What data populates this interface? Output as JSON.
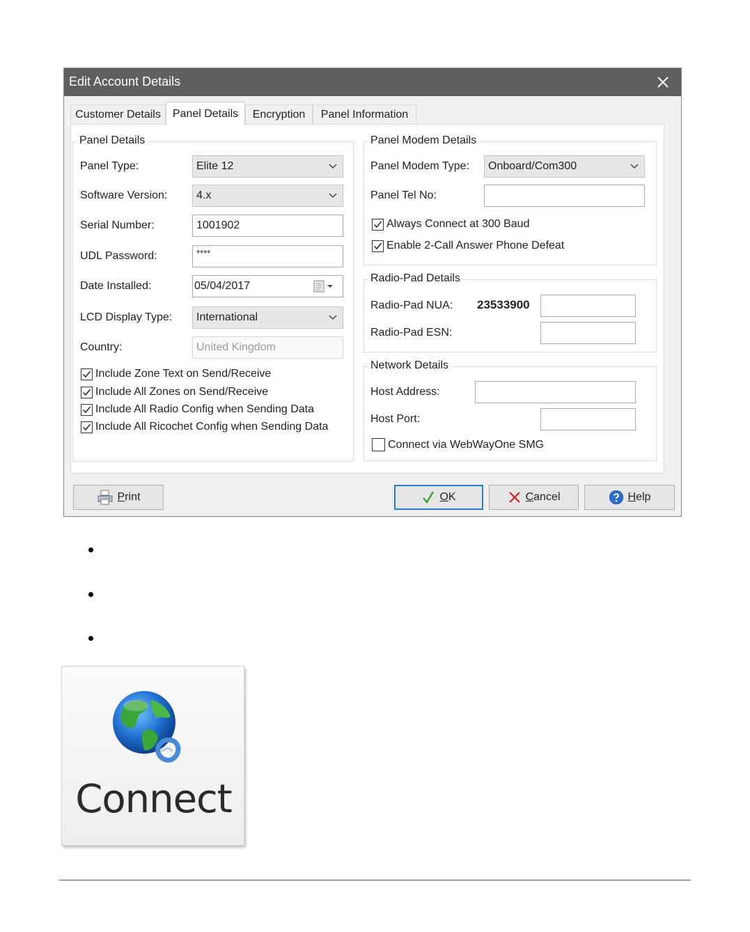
{
  "dialog": {
    "title": "Edit Account Details",
    "tabs": [
      "Customer Details",
      "Panel Details",
      "Encryption",
      "Panel Information"
    ],
    "panel_details": {
      "legend": "Panel Details",
      "panel_type_label": "Panel Type:",
      "panel_type_value": "Elite 12",
      "software_version_label": "Software Version:",
      "software_version_value": "4.x",
      "serial_number_label": "Serial Number:",
      "serial_number_value": "1001902",
      "udl_password_label": "UDL Password:",
      "udl_password_value": "****",
      "date_installed_label": "Date Installed:",
      "date_installed_value": "05/04/2017",
      "lcd_display_type_label": "LCD Display Type:",
      "lcd_display_type_value": "International",
      "country_label": "Country:",
      "country_value": "United Kingdom",
      "checkboxes": [
        {
          "label": "Include Zone Text on Send/Receive",
          "checked": true
        },
        {
          "label": "Include All Zones on Send/Receive",
          "checked": true
        },
        {
          "label": "Include All Radio Config when Sending Data",
          "checked": true
        },
        {
          "label": "Include All Ricochet Config when Sending Data",
          "checked": true
        }
      ]
    },
    "panel_modem_details": {
      "legend": "Panel Modem Details",
      "modem_type_label": "Panel Modem Type:",
      "modem_type_value": "Onboard/Com300",
      "tel_no_label": "Panel Tel No:",
      "tel_no_value": "",
      "checkboxes": [
        {
          "label": "Always Connect at 300 Baud",
          "checked": true
        },
        {
          "label": "Enable 2-Call Answer Phone Defeat",
          "checked": true
        }
      ]
    },
    "radio_pad_details": {
      "legend": "Radio-Pad Details",
      "nua_label": "Radio-Pad NUA:",
      "nua_prefix": "23533900",
      "nua_value": "",
      "esn_label": "Radio-Pad ESN:",
      "esn_value": ""
    },
    "network_details": {
      "legend": "Network Details",
      "host_address_label": "Host Address:",
      "host_address_value": "",
      "host_port_label": "Host Port:",
      "host_port_value": "",
      "webwayone_label": "Connect via WebWayOne SMG",
      "webwayone_checked": false
    },
    "buttons": {
      "print_accel": "P",
      "print_rest": "rint",
      "ok_accel": "O",
      "ok_rest": "K",
      "cancel_accel": "C",
      "cancel_rest": "ancel",
      "help_accel": "H",
      "help_rest": "elp"
    }
  },
  "connect_tile": {
    "label": "Connect",
    "icon": "globe-network-icon"
  },
  "colors": {
    "titlebar": "#5f5f5f",
    "ok_border": "#2b7cd3",
    "cancel_x": "#d92020",
    "ok_check": "#2e9a2e"
  }
}
